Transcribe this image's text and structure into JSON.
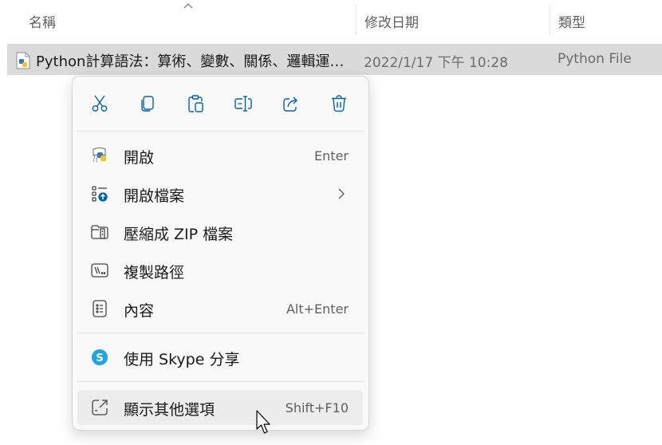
{
  "header": {
    "col_name": "名稱",
    "col_date": "修改日期",
    "col_type": "類型"
  },
  "file": {
    "name": "Python計算語法：算術、變數、關係、邏輯運…",
    "date": "2022/1/17 下午 10:28",
    "type": "Python File",
    "icon": "python-file-icon"
  },
  "context_menu": {
    "actions": [
      {
        "name": "cut",
        "icon": "scissors-icon"
      },
      {
        "name": "copy",
        "icon": "copy-icon"
      },
      {
        "name": "paste",
        "icon": "paste-icon"
      },
      {
        "name": "rename",
        "icon": "rename-icon"
      },
      {
        "name": "share",
        "icon": "share-icon"
      },
      {
        "name": "delete",
        "icon": "trash-icon"
      }
    ],
    "items": [
      {
        "label": "開啟",
        "shortcut": "Enter",
        "icon": "python-launcher-icon"
      },
      {
        "label": "開啟檔案",
        "shortcut": "",
        "icon": "open-with-icon",
        "submenu": true
      },
      {
        "label": "壓縮成 ZIP 檔案",
        "shortcut": "",
        "icon": "zip-folder-icon"
      },
      {
        "label": "複製路徑",
        "shortcut": "",
        "icon": "copy-path-icon"
      },
      {
        "label": "內容",
        "shortcut": "Alt+Enter",
        "icon": "properties-icon"
      },
      {
        "label": "使用 Skype 分享",
        "shortcut": "",
        "icon": "skype-icon"
      },
      {
        "label": "顯示其他選項",
        "shortcut": "Shift+F10",
        "icon": "more-options-icon"
      }
    ]
  },
  "colors": {
    "selection": "#dadada",
    "menu_bg": "#f9f9f9",
    "hover": "#ececec",
    "skype": "#1ea4e9",
    "accent_blue": "#0063b1"
  }
}
